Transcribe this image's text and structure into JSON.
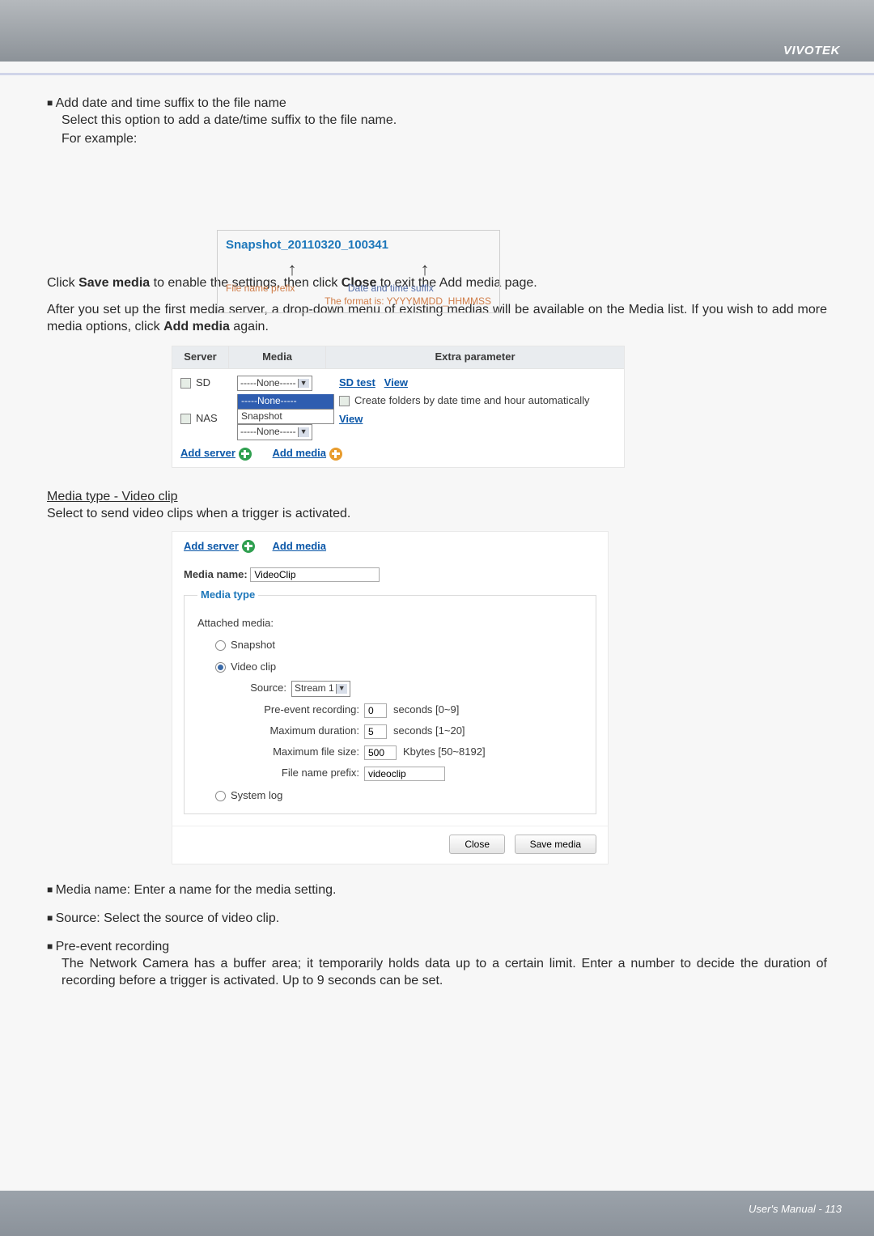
{
  "brand": "VIVOTEK",
  "footer": "User's Manual - 113",
  "intro": {
    "bullet": "Add date and time suffix to the file name",
    "line2": "Select this option to add a date/time suffix to the file name.",
    "line3": "For example:"
  },
  "example_box": {
    "filename": "Snapshot_20110320_100341",
    "prefix_label": "File name prefix",
    "suffix_label": "Date and time suffix",
    "format_label": "The format is: YYYYMMDD_HHMMSS"
  },
  "p_save": {
    "pre": "Click ",
    "save": "Save media",
    "mid": " to enable the settings, then click ",
    "close": "Close",
    "post": " to exit the Add media page."
  },
  "p_after": {
    "pre": "After you set up the first media server, a drop-down menu of existing medias will be available on the Media list. If you wish to add more media options, click ",
    "addmedia": "Add media",
    "post": " again."
  },
  "tbl": {
    "h_server": "Server",
    "h_media": "Media",
    "h_extra": "Extra parameter",
    "row_sd": "SD",
    "row_nas": "NAS",
    "none": "-----None-----",
    "none_hl": "-----None-----",
    "snapshot": "Snapshot",
    "sdtest": "SD test",
    "view": "View",
    "create_folders": "Create folders by date time and hour automatically",
    "add_server": "Add server",
    "add_media": "Add media"
  },
  "section2": {
    "heading": "Media type - Video clip",
    "sub": "Select to send video clips when a trigger is activated."
  },
  "form": {
    "add_server": "Add server",
    "add_media": "Add media",
    "media_name_label": "Media name:",
    "media_name_value": "VideoClip",
    "legend": "Media type",
    "attached": "Attached media:",
    "opt_snapshot": "Snapshot",
    "opt_videoclip": "Video clip",
    "opt_systemlog": "System log",
    "source_label": "Source:",
    "source_value": "Stream 1",
    "preevent_label": "Pre-event recording:",
    "preevent_value": "0",
    "preevent_unit": "seconds [0~9]",
    "maxdur_label": "Maximum duration:",
    "maxdur_value": "5",
    "maxdur_unit": "seconds [1~20]",
    "maxsize_label": "Maximum file size:",
    "maxsize_value": "500",
    "maxsize_unit": "Kbytes [50~8192]",
    "prefix_label": "File name prefix:",
    "prefix_value": "videoclip",
    "btn_close": "Close",
    "btn_save": "Save media"
  },
  "bullets": {
    "b1": "Media name: Enter a name for the media setting.",
    "b2": "Source: Select the source of video clip.",
    "b3_head": "Pre-event recording",
    "b3_body": "The Network Camera has a buffer area; it temporarily holds data up to a certain limit. Enter a number to decide the duration of recording before a trigger is activated. Up to 9 seconds can be set."
  }
}
